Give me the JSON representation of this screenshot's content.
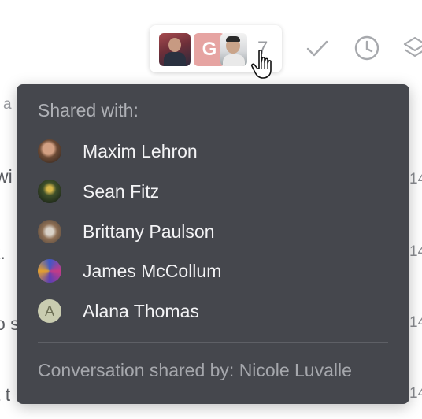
{
  "toolbar": {
    "share_chip": {
      "avatar_2_initial": "G",
      "count": "7"
    },
    "icons": [
      "check-icon",
      "clock-icon",
      "layers-icon",
      "hand-cursor-icon"
    ]
  },
  "background": {
    "left_fragments": [
      "a",
      "wi",
      "t.",
      "o s",
      "t t"
    ],
    "right_fragments": [
      "14",
      "14",
      "14",
      "14"
    ]
  },
  "popover": {
    "heading": "Shared with:",
    "people": [
      {
        "name": "Maxim Lehron",
        "avatar": "photo"
      },
      {
        "name": "Sean Fitz",
        "avatar": "photo"
      },
      {
        "name": "Brittany Paulson",
        "avatar": "photo"
      },
      {
        "name": "James McCollum",
        "avatar": "photo"
      },
      {
        "name": "Alana Thomas",
        "avatar": "initial",
        "initial": "A"
      }
    ],
    "footer": "Conversation shared by: Nicole Luvalle"
  },
  "colors": {
    "popover_bg": "#45474d",
    "popover_text": "#f3f3f5",
    "muted_text": "#aeb0b5",
    "initial_avatar_bg": "#c9ccb0"
  }
}
